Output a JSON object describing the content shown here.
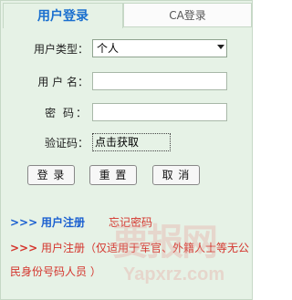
{
  "tabs": {
    "user_login": "用户登录",
    "ca_login": "CA登录"
  },
  "form": {
    "user_type_label": "用户类型：",
    "user_type_value": "个人",
    "username_label": "用 户 名：",
    "password_label": "密  码：",
    "captcha_label": "验证码：",
    "captcha_text": "点击获取"
  },
  "buttons": {
    "login": "登 录",
    "reset": "重 置",
    "cancel": "取 消"
  },
  "links": {
    "arrows": ">>>",
    "user_register": "用户注册",
    "forgot_password": "忘记密码",
    "special_register_line1": "用户注册（仅适用于军官、外籍人士等无公",
    "special_register_line2": "民身份号码人员 ）"
  },
  "watermark": {
    "text": "Yapxrz.com"
  },
  "colors": {
    "panel_bg": "#e6f2e6",
    "link_blue": "#1a5fd0",
    "link_red": "#d4342c",
    "active_tab": "#1a6fcf"
  }
}
